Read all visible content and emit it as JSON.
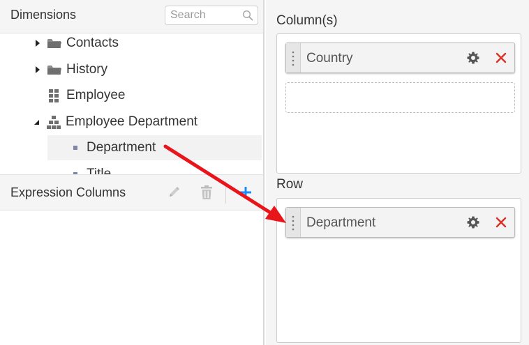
{
  "dimensions": {
    "title": "Dimensions",
    "search_placeholder": "Search",
    "tree": [
      {
        "label": "Contacts",
        "icon": "folder-icon",
        "expandable": true,
        "expanded": false
      },
      {
        "label": "History",
        "icon": "folder-icon",
        "expandable": true,
        "expanded": false
      },
      {
        "label": "Employee",
        "icon": "grid-icon",
        "expandable": false
      },
      {
        "label": "Employee Department",
        "icon": "hierarchy-icon",
        "expandable": true,
        "expanded": true
      },
      {
        "label": "Department",
        "icon": "bullet-icon",
        "selected": true
      },
      {
        "label": "Title",
        "icon": "bullet-icon",
        "partially_visible": true
      }
    ]
  },
  "expression_columns": {
    "title": "Expression Columns",
    "buttons": [
      "edit-icon",
      "delete-icon",
      "add-icon"
    ]
  },
  "columns": {
    "label": "Column(s)",
    "items": [
      {
        "label": "Country"
      }
    ]
  },
  "row": {
    "label": "Row",
    "items": [
      {
        "label": "Department"
      }
    ]
  },
  "colors": {
    "accent_blue": "#1a8cff",
    "close_red": "#d93025",
    "arrow_red": "#e8151b",
    "icon_gray": "#6f6f6f",
    "disabled_gray": "#c4c4c4"
  }
}
